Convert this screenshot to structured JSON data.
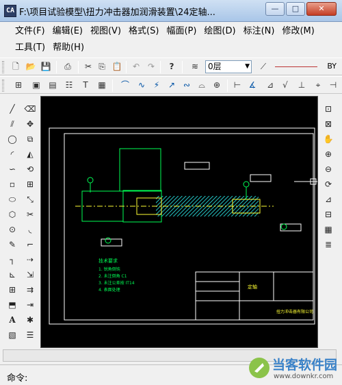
{
  "window": {
    "title": "F:\\项目试验模型\\扭力冲击器加润滑装置\\24定轴...",
    "minimize": "—",
    "maximize": "□",
    "close": "✕"
  },
  "menu": {
    "row1": [
      "文件(F)",
      "编辑(E)",
      "视图(V)",
      "格式(S)",
      "幅面(P)",
      "绘图(D)",
      "标注(N)",
      "修改(M)"
    ],
    "row2": [
      "工具(T)",
      "帮助(H)"
    ]
  },
  "toolbar1": {
    "layer_value": "0层",
    "linetype_value": "BY"
  },
  "drawing": {
    "title_block_name": "定轴",
    "title_block_company": "扭力冲击器有限公司",
    "tech_notes_heading": "技术要求",
    "tech_notes": [
      "1. 锐角倒钝",
      "2. 未注倒角 C1",
      "3. 未注公差按 IT14",
      "4. 表面处理"
    ]
  },
  "command": {
    "label": "命令:"
  },
  "watermark": {
    "name": "当客软件园",
    "url": "www.downkr.com"
  }
}
